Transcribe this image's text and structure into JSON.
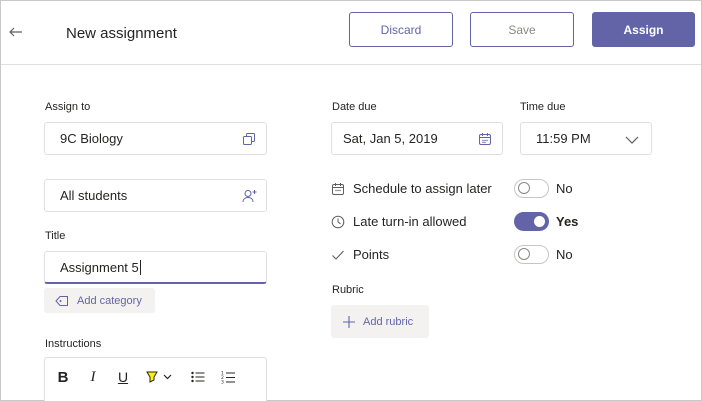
{
  "header": {
    "title": "New assignment",
    "discard_label": "Discard",
    "save_label": "Save",
    "assign_label": "Assign"
  },
  "left": {
    "assign_to_label": "Assign to",
    "class_value": "9C Biology",
    "students_value": "All students",
    "title_label": "Title",
    "title_value": "Assignment 5",
    "add_category_label": "Add category",
    "instructions_label": "Instructions"
  },
  "right": {
    "date_due_label": "Date due",
    "date_due_value": "Sat, Jan 5, 2019",
    "time_due_label": "Time due",
    "time_due_value": "11:59 PM",
    "options": [
      {
        "label": "Schedule to assign later",
        "icon": "calendar-icon",
        "state": "No",
        "on": false
      },
      {
        "label": "Late turn-in allowed",
        "icon": "clock-icon",
        "state": "Yes",
        "on": true
      },
      {
        "label": "Points",
        "icon": "checkmark-icon",
        "state": "No",
        "on": false
      }
    ],
    "rubric_label": "Rubric",
    "add_rubric_label": "Add rubric"
  },
  "editor_toolbar": {
    "bold": "B",
    "italic": "I",
    "underline": "U"
  },
  "colors": {
    "accent": "#6264a7",
    "border": "#e1dfdd",
    "button_bg": "#f3f2f1"
  }
}
